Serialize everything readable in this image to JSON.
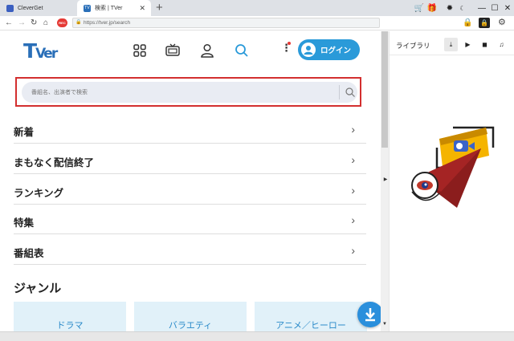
{
  "tabs": [
    {
      "label": "CleverGet",
      "active": false
    },
    {
      "label": "検索 | TVer",
      "active": true
    }
  ],
  "address": {
    "url": "https://tver.jp/search"
  },
  "header": {
    "logo_main": "T",
    "logo_sub": "Ver",
    "login_label": "ログイン"
  },
  "search": {
    "placeholder": "番組名、出演者で検索"
  },
  "menu": [
    {
      "label": "新着"
    },
    {
      "label": "まもなく配信終了"
    },
    {
      "label": "ランキング"
    },
    {
      "label": "特集"
    },
    {
      "label": "番組表"
    }
  ],
  "genre": {
    "title": "ジャンル",
    "cards": [
      {
        "label": "ドラマ"
      },
      {
        "label": "バラエティ"
      },
      {
        "label": "アニメ／ヒーロー"
      }
    ]
  },
  "panel": {
    "title": "ライブラリ"
  },
  "icons": {
    "tab1": "cleverget-icon",
    "tab2": "tver-icon",
    "header": [
      "grid-icon",
      "tv-icon",
      "user-icon",
      "search-icon",
      "more-icon"
    ]
  },
  "colors": {
    "brand": "#2a9ad9",
    "highlight": "#d32f2f",
    "rec": "#e53935",
    "genre_text": "#2a8ac9"
  }
}
